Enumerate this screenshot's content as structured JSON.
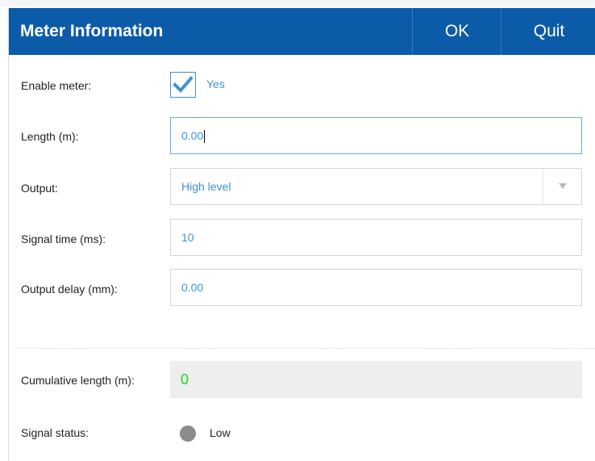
{
  "dialog": {
    "title": "Meter Information",
    "ok_label": "OK",
    "quit_label": "Quit"
  },
  "enable_meter": {
    "label": "Enable meter:",
    "checked": true,
    "text": "Yes"
  },
  "length": {
    "label": "Length (m):",
    "value": "0.00"
  },
  "output": {
    "label": "Output:",
    "value": "High level"
  },
  "signal_time": {
    "label": "Signal time (ms):",
    "value": "10"
  },
  "output_delay": {
    "label": "Output delay (mm):",
    "value": "0.00"
  },
  "cumulative_length": {
    "label": "Cumulative length (m):",
    "value": "0"
  },
  "signal_status": {
    "label": "Signal status:",
    "value": "Low",
    "indicator_color": "#8c8c8c"
  },
  "colors": {
    "titlebar": "#0c5ba8",
    "accent": "#3d93d6",
    "cumulative_value": "#22d422"
  }
}
